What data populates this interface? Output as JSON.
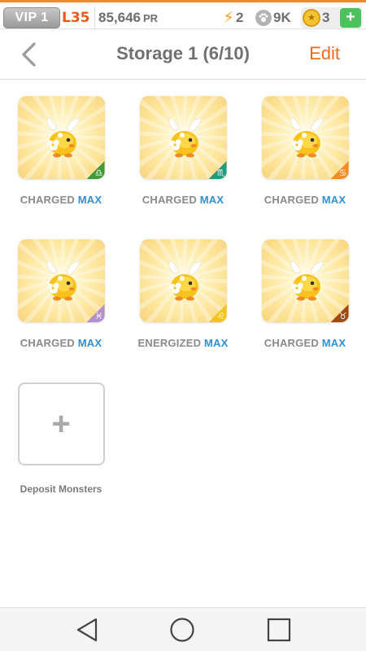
{
  "status_bar": {
    "vip": "VIP 1",
    "level": "L35",
    "power_rating": "85,646",
    "power_rating_unit": "PR",
    "energy": "2",
    "energy_icon": "lightning-bolt-icon",
    "paw_count": "9K",
    "paw_icon": "paw-icon",
    "coins": "3",
    "coin_icon": "coin-icon",
    "add_label": "+"
  },
  "header": {
    "back_icon": "chevron-left-icon",
    "title": "Storage 1 (6/10)",
    "edit_label": "Edit"
  },
  "monsters": [
    {
      "status": "CHARGED",
      "max": "MAX",
      "sign_icon": "libra-icon",
      "sign_glyph": "♎",
      "sign_color": "#3f9b3a"
    },
    {
      "status": "CHARGED",
      "max": "MAX",
      "sign_icon": "scorpio-icon",
      "sign_glyph": "♏",
      "sign_color": "#1f9c7e"
    },
    {
      "status": "CHARGED",
      "max": "MAX",
      "sign_icon": "cancer-icon",
      "sign_glyph": "♋",
      "sign_color": "#f08a24"
    },
    {
      "status": "CHARGED",
      "max": "MAX",
      "sign_icon": "pisces-icon",
      "sign_glyph": "♓",
      "sign_color": "#b38fd0"
    },
    {
      "status": "ENERGIZED",
      "max": "MAX",
      "sign_icon": "leo-icon",
      "sign_glyph": "♌",
      "sign_color": "#f2c318"
    },
    {
      "status": "CHARGED",
      "max": "MAX",
      "sign_icon": "taurus-icon",
      "sign_glyph": "♉",
      "sign_color": "#a04a14"
    }
  ],
  "deposit": {
    "plus": "+",
    "label": "Deposit Monsters"
  },
  "colors": {
    "accent": "#ef6a1e",
    "max_blue": "#2f8fd8",
    "add_green": "#4cc25c"
  },
  "nav": {
    "back_icon": "nav-back-triangle-icon",
    "home_icon": "nav-home-circle-icon",
    "recents_icon": "nav-recents-square-icon"
  }
}
